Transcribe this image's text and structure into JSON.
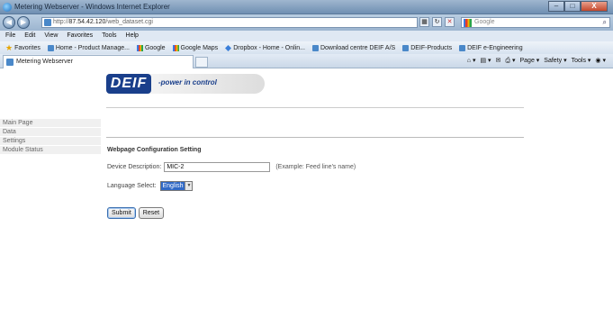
{
  "window": {
    "title": "Metering Webserver - Windows Internet Explorer",
    "controls": {
      "minimize": "–",
      "maximize": "□",
      "close": "X"
    }
  },
  "address_bar": {
    "url_prefix": "http://",
    "url_host": "87.54.42.120",
    "url_path": "/web_dataset.cgi",
    "search_placeholder": "Google"
  },
  "menu": [
    "File",
    "Edit",
    "View",
    "Favorites",
    "Tools",
    "Help"
  ],
  "favorites_bar": {
    "label": "Favorites",
    "items": [
      "Home - Product Manage...",
      "Google",
      "Google Maps",
      "Dropbox - Home - Onlin...",
      "Download centre DEIF A/S",
      "DEIF-Products",
      "DEIF e-Engineering"
    ]
  },
  "tab": {
    "label": "Metering Webserver"
  },
  "command_bar": [
    "Page ▾",
    "Safety ▾",
    "Tools ▾"
  ],
  "logo": {
    "brand": "DEIF",
    "tagline": "-power in control"
  },
  "sidebar": {
    "items": [
      {
        "label": "Main Page"
      },
      {
        "label": "Data"
      },
      {
        "label": "Settings"
      },
      {
        "label": "Module Status"
      }
    ]
  },
  "form": {
    "section_title": "Webpage Configuration Setting",
    "device_label": "Device Description:",
    "device_value": "MIC-2",
    "device_example": "(Example: Feed line's name)",
    "language_label": "Language Select:",
    "language_value": "English",
    "submit_label": "Submit",
    "reset_label": "Reset"
  },
  "colors": {
    "logo_blue": "#1a3f8b",
    "selection_blue": "#3169c6",
    "titlebar": "#6f8fb2"
  }
}
